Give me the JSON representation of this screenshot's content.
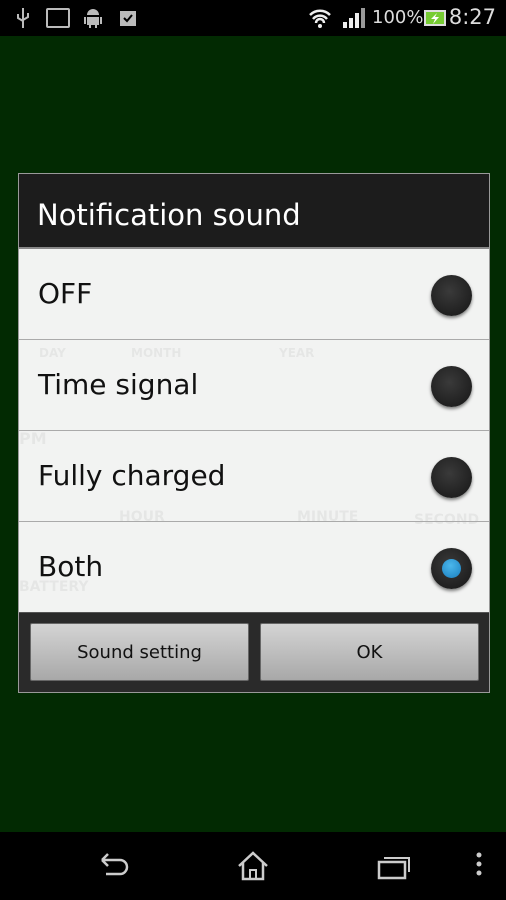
{
  "status_bar": {
    "battery_percent": "100%",
    "time": "8:27",
    "icons": [
      "usb-icon",
      "image-icon",
      "android-icon",
      "clipboard-check-icon",
      "wifi-icon",
      "signal-icon",
      "battery-charging-icon"
    ]
  },
  "dialog": {
    "title": "Notification sound",
    "options": [
      {
        "label": "OFF",
        "selected": false
      },
      {
        "label": "Time signal",
        "selected": false
      },
      {
        "label": "Fully charged",
        "selected": false
      },
      {
        "label": "Both",
        "selected": true
      }
    ],
    "buttons": {
      "sound_setting": "Sound setting",
      "ok": "OK"
    }
  },
  "background_labels": {
    "day": "DAY",
    "month": "MONTH",
    "year": "YEAR",
    "pm": "PM",
    "hour": "HOUR",
    "minute": "MINUTE",
    "second": "SECOND",
    "battery": "BATTERY"
  },
  "colors": {
    "accent": "#2a9ad8",
    "background": "#022a02"
  },
  "nav_bar": {
    "icons": [
      "back-icon",
      "home-icon",
      "recent-apps-icon",
      "menu-icon"
    ]
  }
}
